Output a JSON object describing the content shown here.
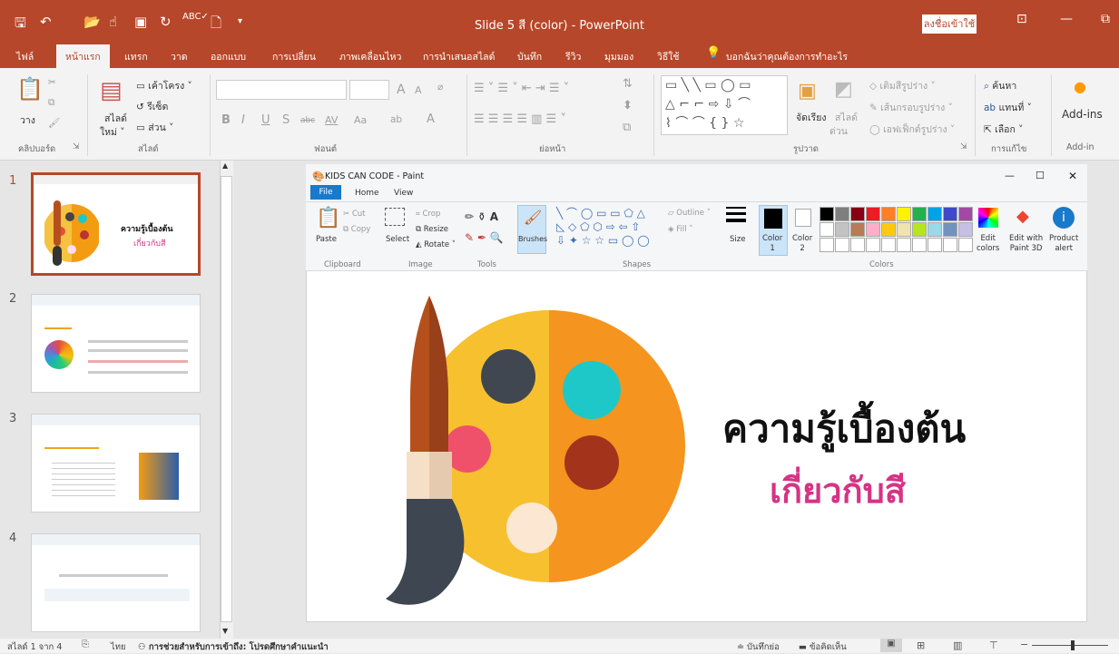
{
  "window": {
    "title": "Slide 5 สี (color)  -  PowerPoint",
    "signin_label": "ลงชื่อเข้าใช้"
  },
  "colors": {
    "accent": "#b7472a",
    "paint_file": "#1979ca",
    "title_pink": "#d63384"
  },
  "tabs": [
    "ไฟล์",
    "หน้าแรก",
    "แทรก",
    "วาด",
    "ออกแบบ",
    "การเปลี่ยน",
    "ภาพเคลื่อนไหว",
    "การนำเสนอสไลด์",
    "บันทึก",
    "รีวิว",
    "มุมมอง",
    "วิธีใช้"
  ],
  "tell_me": "บอกฉันว่าคุณต้องการทำอะไร",
  "ribbon": {
    "clipboard": {
      "paste": "วาง",
      "group": "คลิปบอร์ด"
    },
    "slides": {
      "new_slide": "สไลด์",
      "new_slide2": "ใหม่ ˅",
      "layout": "เค้าโครง ˅",
      "reset": "รีเซ็ต",
      "section": "ส่วน ˅",
      "group": "สไลด์"
    },
    "font": {
      "group": "ฟอนต์",
      "bold": "B",
      "italic": "I",
      "underline": "U",
      "shadow": "S",
      "strike": "abc",
      "spacing": "AV",
      "case": "Aa",
      "size_up": "A",
      "size_down": "A"
    },
    "paragraph": {
      "group": "ย่อหน้า"
    },
    "drawing": {
      "group": "รูปวาด",
      "arrange": "จัดเรียง",
      "quick_styles": "สไลด์",
      "quick_styles2": "ด่วน",
      "fill": "เติมสีรูปร่าง ˅",
      "outline": "เส้นกรอบรูปร่าง ˅",
      "effects": "เอฟเฟ็กต์รูปร่าง ˅"
    },
    "editing": {
      "group": "การแก้ไข",
      "find": "ค้นหา",
      "replace": "แทนที่ ˅",
      "select": "เลือก ˅"
    },
    "addins": {
      "label": "Add-ins",
      "group": "Add-in"
    }
  },
  "thumbnails": [
    {
      "num": "1",
      "title": "ความรู้เบื้องต้น",
      "subtitle": "เกี่ยวกับสี"
    },
    {
      "num": "2"
    },
    {
      "num": "3"
    },
    {
      "num": "4"
    }
  ],
  "paint": {
    "title": "KIDS CAN CODE - Paint",
    "tabs": {
      "file": "File",
      "home": "Home",
      "view": "View"
    },
    "clipboard": {
      "paste": "Paste",
      "cut": "Cut",
      "copy": "Copy",
      "group": "Clipboard"
    },
    "image": {
      "select": "Select",
      "crop": "Crop",
      "resize": "Resize",
      "rotate": "Rotate ˅",
      "group": "Image"
    },
    "tools": {
      "group": "Tools",
      "brushes": "Brushes"
    },
    "shapes": {
      "outline": "Outline ˅",
      "fill": "Fill ˅",
      "group": "Shapes"
    },
    "size": "Size",
    "color1": "Color\n1",
    "color2": "Color\n2",
    "colors_group": "Colors",
    "edit_colors": "Edit\ncolors",
    "edit_3d": "Edit with\nPaint 3D",
    "product_alert": "Product\nalert",
    "palette": [
      "#000000",
      "#7f7f7f",
      "#880015",
      "#ed1c24",
      "#ff7f27",
      "#fff200",
      "#22b14c",
      "#00a2e8",
      "#3f48cc",
      "#a349a4",
      "#ffffff",
      "#c3c3c3",
      "#b97a57",
      "#ffaec9",
      "#ffc90e",
      "#efe4b0",
      "#b5e61d",
      "#99d9ea",
      "#7092be",
      "#c8bfe7"
    ]
  },
  "slide": {
    "title": "ความรู้เบื้องต้น",
    "subtitle": "เกี่ยวกับสี"
  },
  "status": {
    "slide_count": "สไลด์ 1 จาก 4",
    "language": "ไทย",
    "accessibility": "การช่วยสำหรับการเข้าถึง: โปรดศึกษาคำแนะนำ",
    "notes": "บันทึกย่อ",
    "comments": "ข้อคิดเห็น"
  }
}
